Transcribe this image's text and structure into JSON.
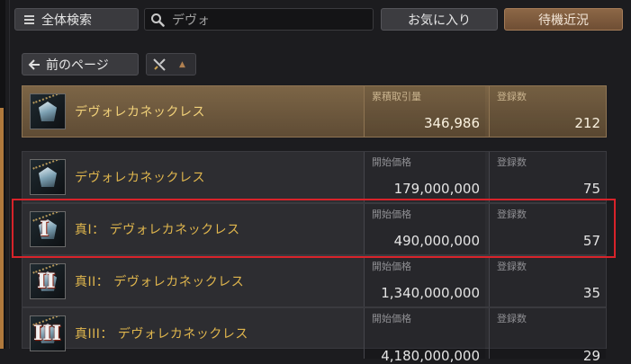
{
  "top_bar": {
    "search_all_label": "全体検索",
    "search_value": "デヴォ",
    "favorites_label": "お気に入り",
    "waiting_label": "待機近況"
  },
  "nav": {
    "prev_page_label": "前のページ",
    "sort_arrow": "▲"
  },
  "header_row": {
    "name": "デヴォレカネックレス",
    "col1_label": "累積取引量",
    "col1_value": "346,986",
    "col2_label": "登録数",
    "col2_value": "212"
  },
  "items": [
    {
      "tier": "",
      "name": "デヴォレカネックレス",
      "price_label": "開始価格",
      "price": "179,000,000",
      "count_label": "登録数",
      "count": "75"
    },
    {
      "tier": "I",
      "name": "真I： デヴォレカネックレス",
      "price_label": "開始価格",
      "price": "490,000,000",
      "count_label": "登録数",
      "count": "57"
    },
    {
      "tier": "II",
      "name": "真II： デヴォレカネックレス",
      "price_label": "開始価格",
      "price": "1,340,000,000",
      "count_label": "登録数",
      "count": "35"
    },
    {
      "tier": "III",
      "name": "真III： デヴォレカネックレス",
      "price_label": "開始価格",
      "price": "4,180,000,000",
      "count_label": "登録数",
      "count": "29"
    }
  ],
  "icons": {
    "list": "list-icon",
    "search": "search-icon",
    "arrow_left": "arrow-left-icon",
    "sort": "crossed-swords-icon",
    "item": "necklace-icon"
  },
  "colors": {
    "accent_gold": "#e0b64d",
    "highlight_bg": "#7c6546",
    "selection_frame": "#d8232a",
    "waiting_button": "#8c6746"
  }
}
